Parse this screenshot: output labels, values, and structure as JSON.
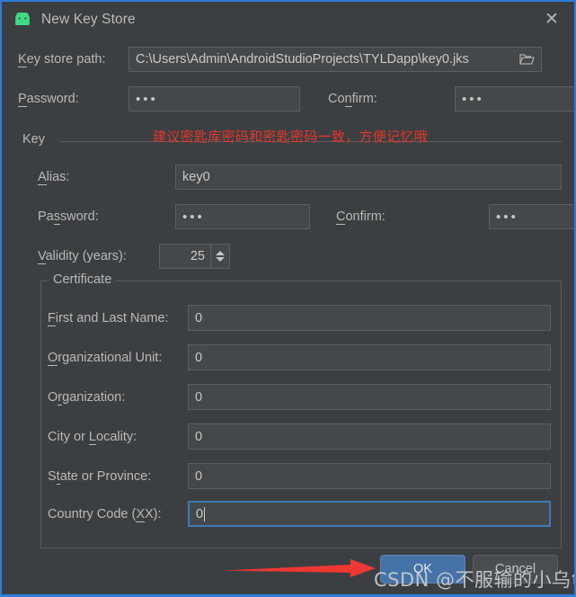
{
  "window": {
    "title": "New Key Store",
    "icon": "android-robot-icon",
    "close_label": "✕",
    "border_color": "#2d7cd6",
    "background": "#3c3f41"
  },
  "keystore": {
    "path_label": "Key store path:",
    "path_value": "C:\\Users\\Admin\\AndroidStudioProjects\\TYLDapp\\key0.jks",
    "browse_icon": "folder-icon",
    "password_label": "Password:",
    "password_value": "•••",
    "confirm_label": "Confirm:",
    "confirm_value": "•••"
  },
  "key_group": {
    "legend": "Key",
    "annotation": "建议密匙库密码和密匙密码一致，方便记忆哦",
    "annotation_color": "#e8352b",
    "alias_label": "Alias:",
    "alias_value": "key0",
    "password_label": "Password:",
    "password_value": "•••",
    "confirm_label": "Confirm:",
    "confirm_value": "•••",
    "validity_label": "Validity (years):",
    "validity_value": "25"
  },
  "certificate": {
    "legend": "Certificate",
    "fields": [
      {
        "label": "First and Last Name:",
        "value": "0",
        "focused": false
      },
      {
        "label": "Organizational Unit:",
        "value": "0",
        "focused": false
      },
      {
        "label": "Organization:",
        "value": "0",
        "focused": false
      },
      {
        "label": "City or Locality:",
        "value": "0",
        "focused": false
      },
      {
        "label": "State or Province:",
        "value": "0",
        "focused": false
      },
      {
        "label": "Country Code (XX):",
        "value": "0",
        "focused": true
      }
    ]
  },
  "buttons": {
    "ok": "OK",
    "cancel": "Cancel",
    "ok_color": "#4573a8"
  },
  "overlay": {
    "watermark": "CSDN @不服输的小乌龟",
    "arrow_color": "#ef3833"
  }
}
